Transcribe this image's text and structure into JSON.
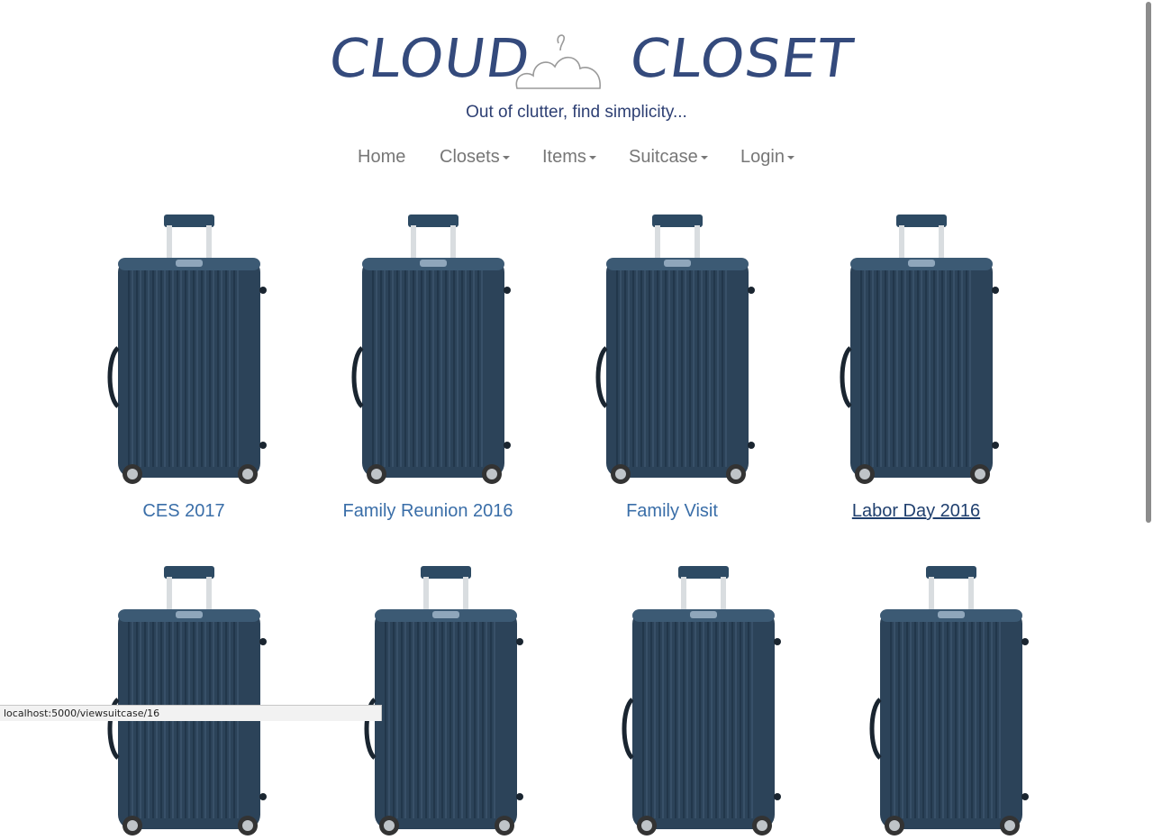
{
  "brand": {
    "left_word": "CLOUD",
    "right_word": "CLOSET",
    "logo_icon": "hanger-cloud-icon"
  },
  "tagline": "Out of clutter, find simplicity...",
  "nav": [
    {
      "label": "Home",
      "dropdown": false
    },
    {
      "label": "Closets",
      "dropdown": true
    },
    {
      "label": "Items",
      "dropdown": true
    },
    {
      "label": "Suitcase",
      "dropdown": true
    },
    {
      "label": "Login",
      "dropdown": true
    }
  ],
  "suitcases": [
    {
      "label": "CES 2017"
    },
    {
      "label": "Family Reunion 2016"
    },
    {
      "label": "Family Visit"
    },
    {
      "label": "Labor Day 2016",
      "hovered": true
    },
    {
      "label": ""
    },
    {
      "label": ""
    },
    {
      "label": ""
    },
    {
      "label": ""
    }
  ],
  "status_bar": {
    "url": "localhost:5000/viewsuitcase/16"
  },
  "colors": {
    "brand": "#344a7c",
    "link": "#3a6ea8",
    "nav": "#777777",
    "suitcase_body": "#2c4359"
  }
}
